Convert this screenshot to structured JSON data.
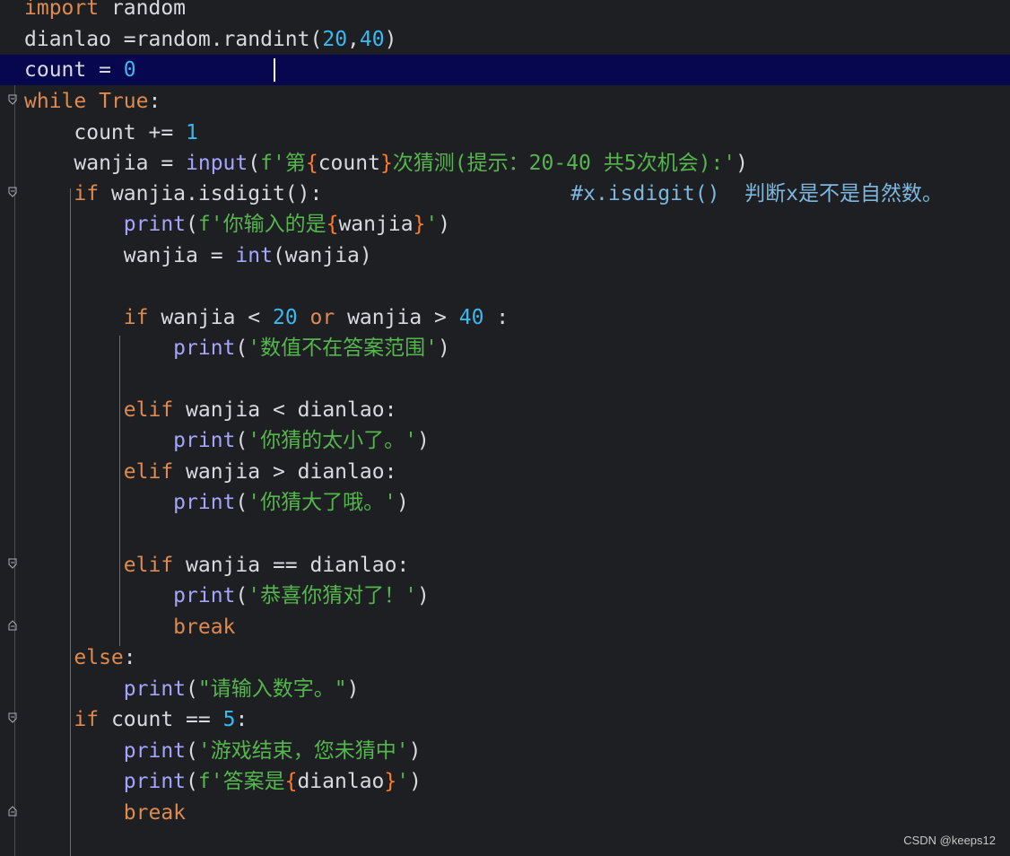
{
  "editor": {
    "lines": [
      {
        "segments": [
          {
            "text": "import",
            "cls": "kw"
          },
          {
            "text": " random",
            "cls": "plain"
          }
        ]
      },
      {
        "segments": [
          {
            "text": "dianlao =random.randint(",
            "cls": "plain"
          },
          {
            "text": "20",
            "cls": "num"
          },
          {
            "text": ",",
            "cls": "plain"
          },
          {
            "text": "40",
            "cls": "num"
          },
          {
            "text": ")",
            "cls": "plain"
          }
        ]
      },
      {
        "segments": [
          {
            "text": "count = ",
            "cls": "plain"
          },
          {
            "text": "0",
            "cls": "num"
          }
        ]
      },
      {
        "segments": [
          {
            "text": "while ",
            "cls": "kw"
          },
          {
            "text": "True",
            "cls": "kw"
          },
          {
            "text": ":",
            "cls": "plain"
          }
        ]
      },
      {
        "segments": [
          {
            "text": "    count += ",
            "cls": "plain"
          },
          {
            "text": "1",
            "cls": "num"
          }
        ]
      },
      {
        "segments": [
          {
            "text": "    wanjia = ",
            "cls": "plain"
          },
          {
            "text": "input",
            "cls": "fn"
          },
          {
            "text": "(",
            "cls": "plain"
          },
          {
            "text": "f'第",
            "cls": "str"
          },
          {
            "text": "{",
            "cls": "brace"
          },
          {
            "text": "count",
            "cls": "plain"
          },
          {
            "text": "}",
            "cls": "brace"
          },
          {
            "text": "次猜测(提示：20-40 共5次机会):'",
            "cls": "str"
          },
          {
            "text": ")",
            "cls": "plain"
          }
        ]
      },
      {
        "segments": [
          {
            "text": "    ",
            "cls": "plain"
          },
          {
            "text": "if",
            "cls": "kw"
          },
          {
            "text": " wanjia.isdigit():",
            "cls": "plain"
          },
          {
            "text": "                    #x.isdigit()  判断x是不是自然数。",
            "cls": "cmt"
          }
        ]
      },
      {
        "segments": [
          {
            "text": "        ",
            "cls": "plain"
          },
          {
            "text": "print",
            "cls": "fn"
          },
          {
            "text": "(",
            "cls": "plain"
          },
          {
            "text": "f'你输入的是",
            "cls": "str"
          },
          {
            "text": "{",
            "cls": "brace"
          },
          {
            "text": "wanjia",
            "cls": "plain"
          },
          {
            "text": "}",
            "cls": "brace"
          },
          {
            "text": "'",
            "cls": "str"
          },
          {
            "text": ")",
            "cls": "plain"
          }
        ]
      },
      {
        "segments": [
          {
            "text": "        wanjia = ",
            "cls": "plain"
          },
          {
            "text": "int",
            "cls": "fn"
          },
          {
            "text": "(wanjia)",
            "cls": "plain"
          }
        ]
      },
      {
        "segments": [
          {
            "text": "",
            "cls": "plain"
          }
        ]
      },
      {
        "segments": [
          {
            "text": "        ",
            "cls": "plain"
          },
          {
            "text": "if",
            "cls": "kw"
          },
          {
            "text": " wanjia < ",
            "cls": "plain"
          },
          {
            "text": "20",
            "cls": "num"
          },
          {
            "text": " ",
            "cls": "plain"
          },
          {
            "text": "or",
            "cls": "kw"
          },
          {
            "text": " wanjia > ",
            "cls": "plain"
          },
          {
            "text": "40",
            "cls": "num"
          },
          {
            "text": " :",
            "cls": "plain"
          }
        ]
      },
      {
        "segments": [
          {
            "text": "            ",
            "cls": "plain"
          },
          {
            "text": "print",
            "cls": "fn"
          },
          {
            "text": "(",
            "cls": "plain"
          },
          {
            "text": "'数值不在答案范围'",
            "cls": "str"
          },
          {
            "text": ")",
            "cls": "plain"
          }
        ]
      },
      {
        "segments": [
          {
            "text": "",
            "cls": "plain"
          }
        ]
      },
      {
        "segments": [
          {
            "text": "        ",
            "cls": "plain"
          },
          {
            "text": "elif",
            "cls": "kw"
          },
          {
            "text": " wanjia < dianlao:",
            "cls": "plain"
          }
        ]
      },
      {
        "segments": [
          {
            "text": "            ",
            "cls": "plain"
          },
          {
            "text": "print",
            "cls": "fn"
          },
          {
            "text": "(",
            "cls": "plain"
          },
          {
            "text": "'你猜的太小了。'",
            "cls": "str"
          },
          {
            "text": ")",
            "cls": "plain"
          }
        ]
      },
      {
        "segments": [
          {
            "text": "        ",
            "cls": "plain"
          },
          {
            "text": "elif",
            "cls": "kw"
          },
          {
            "text": " wanjia > dianlao:",
            "cls": "plain"
          }
        ]
      },
      {
        "segments": [
          {
            "text": "            ",
            "cls": "plain"
          },
          {
            "text": "print",
            "cls": "fn"
          },
          {
            "text": "(",
            "cls": "plain"
          },
          {
            "text": "'你猜大了哦。'",
            "cls": "str"
          },
          {
            "text": ")",
            "cls": "plain"
          }
        ]
      },
      {
        "segments": [
          {
            "text": "",
            "cls": "plain"
          }
        ]
      },
      {
        "segments": [
          {
            "text": "        ",
            "cls": "plain"
          },
          {
            "text": "elif",
            "cls": "kw"
          },
          {
            "text": " wanjia == dianlao:",
            "cls": "plain"
          }
        ]
      },
      {
        "segments": [
          {
            "text": "            ",
            "cls": "plain"
          },
          {
            "text": "print",
            "cls": "fn"
          },
          {
            "text": "(",
            "cls": "plain"
          },
          {
            "text": "'恭喜你猜对了！'",
            "cls": "str"
          },
          {
            "text": ")",
            "cls": "plain"
          }
        ]
      },
      {
        "segments": [
          {
            "text": "            ",
            "cls": "plain"
          },
          {
            "text": "break",
            "cls": "kw"
          }
        ]
      },
      {
        "segments": [
          {
            "text": "    ",
            "cls": "plain"
          },
          {
            "text": "else",
            "cls": "kw"
          },
          {
            "text": ":",
            "cls": "plain"
          }
        ]
      },
      {
        "segments": [
          {
            "text": "        ",
            "cls": "plain"
          },
          {
            "text": "print",
            "cls": "fn"
          },
          {
            "text": "(",
            "cls": "plain"
          },
          {
            "text": "\"请输入数字。\"",
            "cls": "str"
          },
          {
            "text": ")",
            "cls": "plain"
          }
        ]
      },
      {
        "segments": [
          {
            "text": "    ",
            "cls": "plain"
          },
          {
            "text": "if",
            "cls": "kw"
          },
          {
            "text": " count == ",
            "cls": "plain"
          },
          {
            "text": "5",
            "cls": "num"
          },
          {
            "text": ":",
            "cls": "plain"
          }
        ]
      },
      {
        "segments": [
          {
            "text": "        ",
            "cls": "plain"
          },
          {
            "text": "print",
            "cls": "fn"
          },
          {
            "text": "(",
            "cls": "plain"
          },
          {
            "text": "'游戏结束，您未猜中'",
            "cls": "str"
          },
          {
            "text": ")",
            "cls": "plain"
          }
        ]
      },
      {
        "segments": [
          {
            "text": "        ",
            "cls": "plain"
          },
          {
            "text": "print",
            "cls": "fn"
          },
          {
            "text": "(",
            "cls": "plain"
          },
          {
            "text": "f'答案是",
            "cls": "str"
          },
          {
            "text": "{",
            "cls": "brace"
          },
          {
            "text": "dianlao",
            "cls": "plain"
          },
          {
            "text": "}",
            "cls": "brace"
          },
          {
            "text": "'",
            "cls": "str"
          },
          {
            "text": ")",
            "cls": "plain"
          }
        ]
      },
      {
        "segments": [
          {
            "text": "        ",
            "cls": "plain"
          },
          {
            "text": "break",
            "cls": "kw"
          }
        ]
      }
    ]
  },
  "watermark": "CSDN @keeps12",
  "colors": {
    "background": "#1e1f22",
    "current_line": "#07074f",
    "keyword": "#df8a4f",
    "builtin": "#a5a5ff",
    "number": "#38b9f0",
    "string": "#55b64d",
    "comment": "#7cb8df",
    "fstring_brace": "#ff7b29",
    "text": "#d8dadf"
  }
}
